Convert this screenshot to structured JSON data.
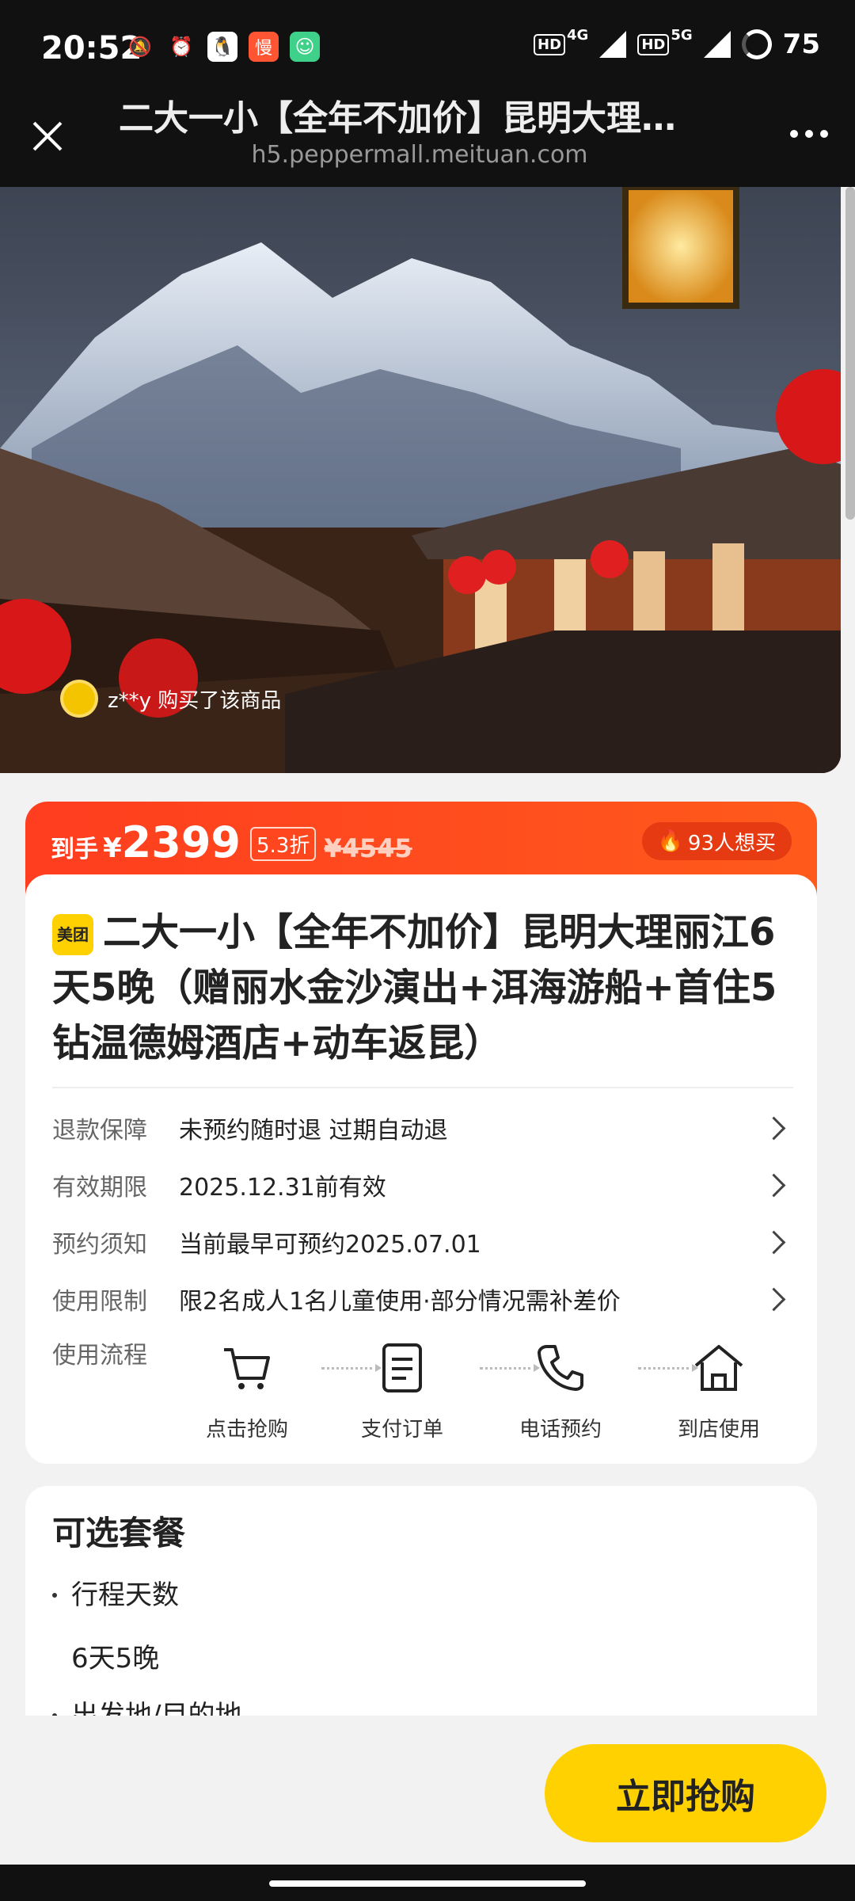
{
  "status_bar": {
    "time": "20:52",
    "network1": "4G",
    "network2": "5G",
    "hd1": "HD",
    "hd2": "HD",
    "battery": "75",
    "app_icon_3": "慢"
  },
  "nav": {
    "title": "二大一小【全年不加价】昆明大理…",
    "url": "h5.peppermall.meituan.com"
  },
  "hero": {
    "buyer_notice": "z**y 购买了该商品"
  },
  "price": {
    "prefix": "到手",
    "currency": "¥",
    "value": "2399",
    "discount": "5.3折",
    "original": "¥4545",
    "want_count": "93人想买"
  },
  "product": {
    "brand_badge": "美团",
    "title": "二大一小【全年不加价】昆明大理丽江6天5晚（赠丽水金沙演出+洱海游船+首住5钻温德姆酒店+动车返昆）",
    "info_rows": [
      {
        "label": "退款保障",
        "value": "未预约随时退 过期自动退"
      },
      {
        "label": "有效期限",
        "value": "2025.12.31前有效"
      },
      {
        "label": "预约须知",
        "value": "当前最早可预约2025.07.01"
      },
      {
        "label": "使用限制",
        "value": "限2名成人1名儿童使用·部分情况需补差价"
      }
    ],
    "flow_label": "使用流程",
    "flow_steps": [
      {
        "label": "点击抢购",
        "icon": "cart-icon"
      },
      {
        "label": "支付订单",
        "icon": "order-icon"
      },
      {
        "label": "电话预约",
        "icon": "phone-icon"
      },
      {
        "label": "到店使用",
        "icon": "home-icon"
      }
    ]
  },
  "packages": {
    "title": "可选套餐",
    "items": [
      {
        "name": "行程天数",
        "value": "6天5晚"
      },
      {
        "name": "出发地/目的地"
      }
    ]
  },
  "bottom": {
    "buy_label": "立即抢购"
  },
  "colors": {
    "accent": "#ff4a1c",
    "brand_yellow": "#ffd100"
  }
}
